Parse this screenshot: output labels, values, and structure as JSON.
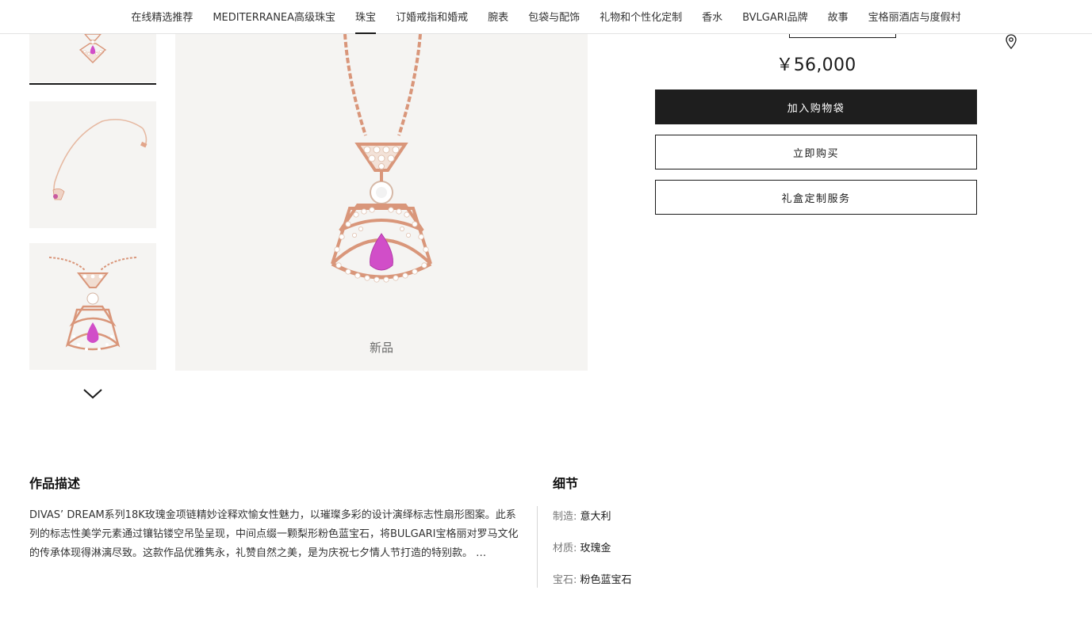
{
  "nav": {
    "items": [
      {
        "label": "在线精选推荐"
      },
      {
        "label": "MEDITERRANEA高级珠宝"
      },
      {
        "label": "珠宝"
      },
      {
        "label": "订婚戒指和婚戒"
      },
      {
        "label": "腕表"
      },
      {
        "label": "包袋与配饰"
      },
      {
        "label": "礼物和个性化定制"
      },
      {
        "label": "香水"
      },
      {
        "label": "BVLGARI品牌"
      },
      {
        "label": "故事"
      },
      {
        "label": "宝格丽酒店与度假村"
      }
    ],
    "active_label": "珠宝"
  },
  "gallery": {
    "new_tag": "新品",
    "next_icon": "chevron-down-icon"
  },
  "product": {
    "price": "￥56,000",
    "add_to_bag": "加入购物袋",
    "buy_now": "立即购买",
    "gift_service": "礼盒定制服务",
    "store_icon": "map-pin-icon"
  },
  "description": {
    "title": "作品描述",
    "text": "DIVAS’ DREAM系列18K玫瑰金项链精妙诠释欢愉女性魅力，以璀璨多彩的设计演绎标志性扇形图案。此系列的标志性美学元素通过镶钻镂空吊坠呈现，中间点缀一颗梨形粉色蓝宝石，将BULGARI宝格丽对罗马文化的传承体现得淋漓尽致。这款作品优雅隽永，礼赞自然之美，是为庆祝七夕情人节打造的特别款。 …"
  },
  "details": {
    "title": "细节",
    "rows": [
      {
        "key": "制造: ",
        "value": "意大利"
      },
      {
        "key": "材质: ",
        "value": "玫瑰金"
      },
      {
        "key": "宝石: ",
        "value": "粉色蓝宝石"
      }
    ]
  },
  "colors": {
    "rose_gold": "#d9967a",
    "pink_sapphire": "#d14ec8",
    "diamond": "#ffffff",
    "image_bg": "#f5f4f2",
    "primary_button": "#1e1e1e"
  }
}
